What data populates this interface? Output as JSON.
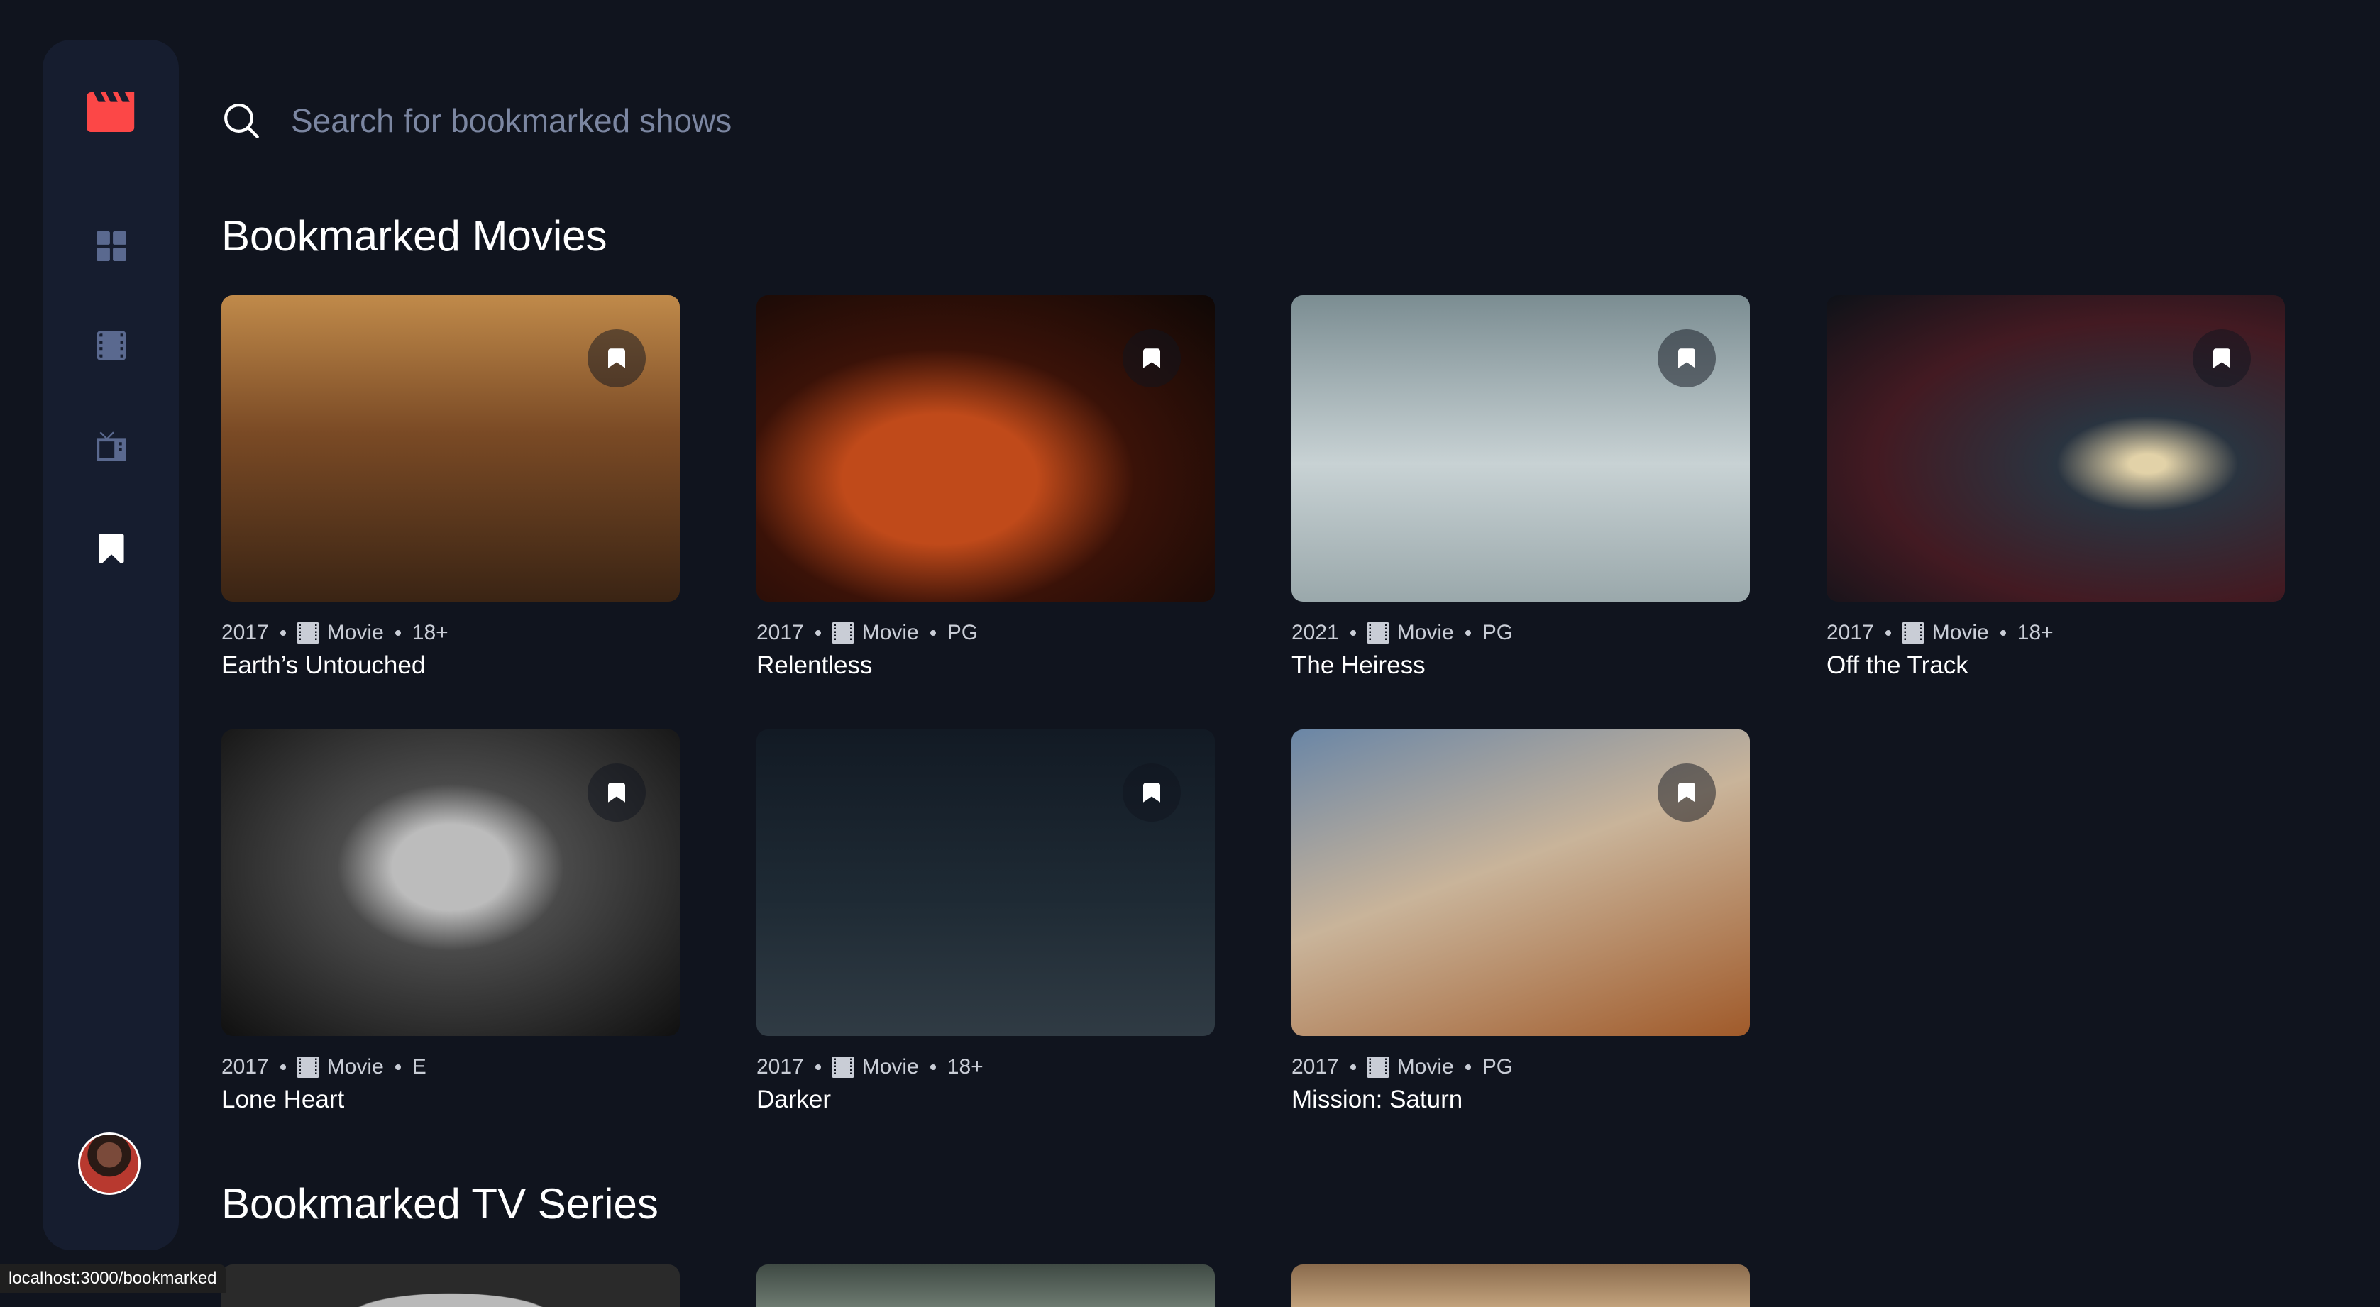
{
  "app": {
    "accent_color": "#FC4747",
    "background": "#10141E",
    "sidebar_bg": "#161D2F"
  },
  "sidebar": {
    "logo_icon": "film-clapper-icon",
    "items": [
      {
        "name": "home",
        "icon": "grid-icon",
        "active": false
      },
      {
        "name": "movies",
        "icon": "film-icon",
        "active": false
      },
      {
        "name": "tv-series",
        "icon": "tv-icon",
        "active": false
      },
      {
        "name": "bookmarked",
        "icon": "bookmark-icon",
        "active": true
      }
    ],
    "avatar_icon": "user-avatar"
  },
  "search": {
    "placeholder": "Search for bookmarked shows",
    "value": ""
  },
  "sections": {
    "movies_title": "Bookmarked Movies",
    "tv_title": "Bookmarked TV Series"
  },
  "movies": [
    {
      "year": "2017",
      "category": "Movie",
      "rating": "18+",
      "title": "Earth’s Untouched"
    },
    {
      "year": "2017",
      "category": "Movie",
      "rating": "PG",
      "title": "Relentless"
    },
    {
      "year": "2021",
      "category": "Movie",
      "rating": "PG",
      "title": "The Heiress"
    },
    {
      "year": "2017",
      "category": "Movie",
      "rating": "18+",
      "title": "Off the Track"
    },
    {
      "year": "2017",
      "category": "Movie",
      "rating": "E",
      "title": "Lone Heart"
    },
    {
      "year": "2017",
      "category": "Movie",
      "rating": "18+",
      "title": "Darker"
    },
    {
      "year": "2017",
      "category": "Movie",
      "rating": "PG",
      "title": "Mission: Saturn"
    }
  ],
  "status_url": "localhost:3000/bookmarked"
}
